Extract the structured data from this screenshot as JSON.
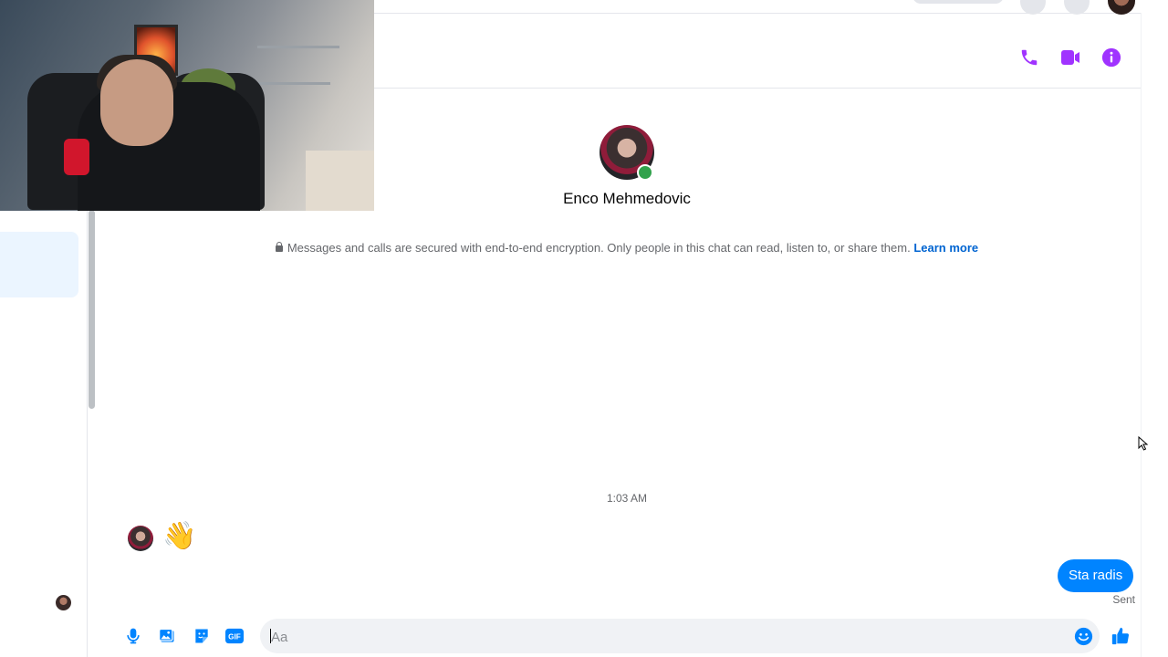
{
  "colors": {
    "accent": "#a033ff",
    "messenger_blue": "#0084ff",
    "link_blue": "#0064d1",
    "online_green": "#31a24c",
    "muted_text": "#65676b"
  },
  "header": {
    "icons": [
      "phone-icon",
      "video-icon",
      "info-icon"
    ]
  },
  "conversation": {
    "contact_name": "Enco Mehmedovic",
    "encryption_notice": "Messages and calls are secured with end-to-end encryption. Only people in this chat can read, listen to, or share them.",
    "learn_more": "Learn more",
    "timestamp": "1:03 AM",
    "received_message": "👋",
    "sent_message": "Sta radis",
    "sent_status": "Sent"
  },
  "composer": {
    "placeholder": "Aa",
    "value": "",
    "icons": [
      "microphone-icon",
      "gallery-icon",
      "sticker-icon",
      "gif-icon",
      "emoji-icon",
      "thumbs-up-icon"
    ],
    "gif_label": "GIF"
  }
}
